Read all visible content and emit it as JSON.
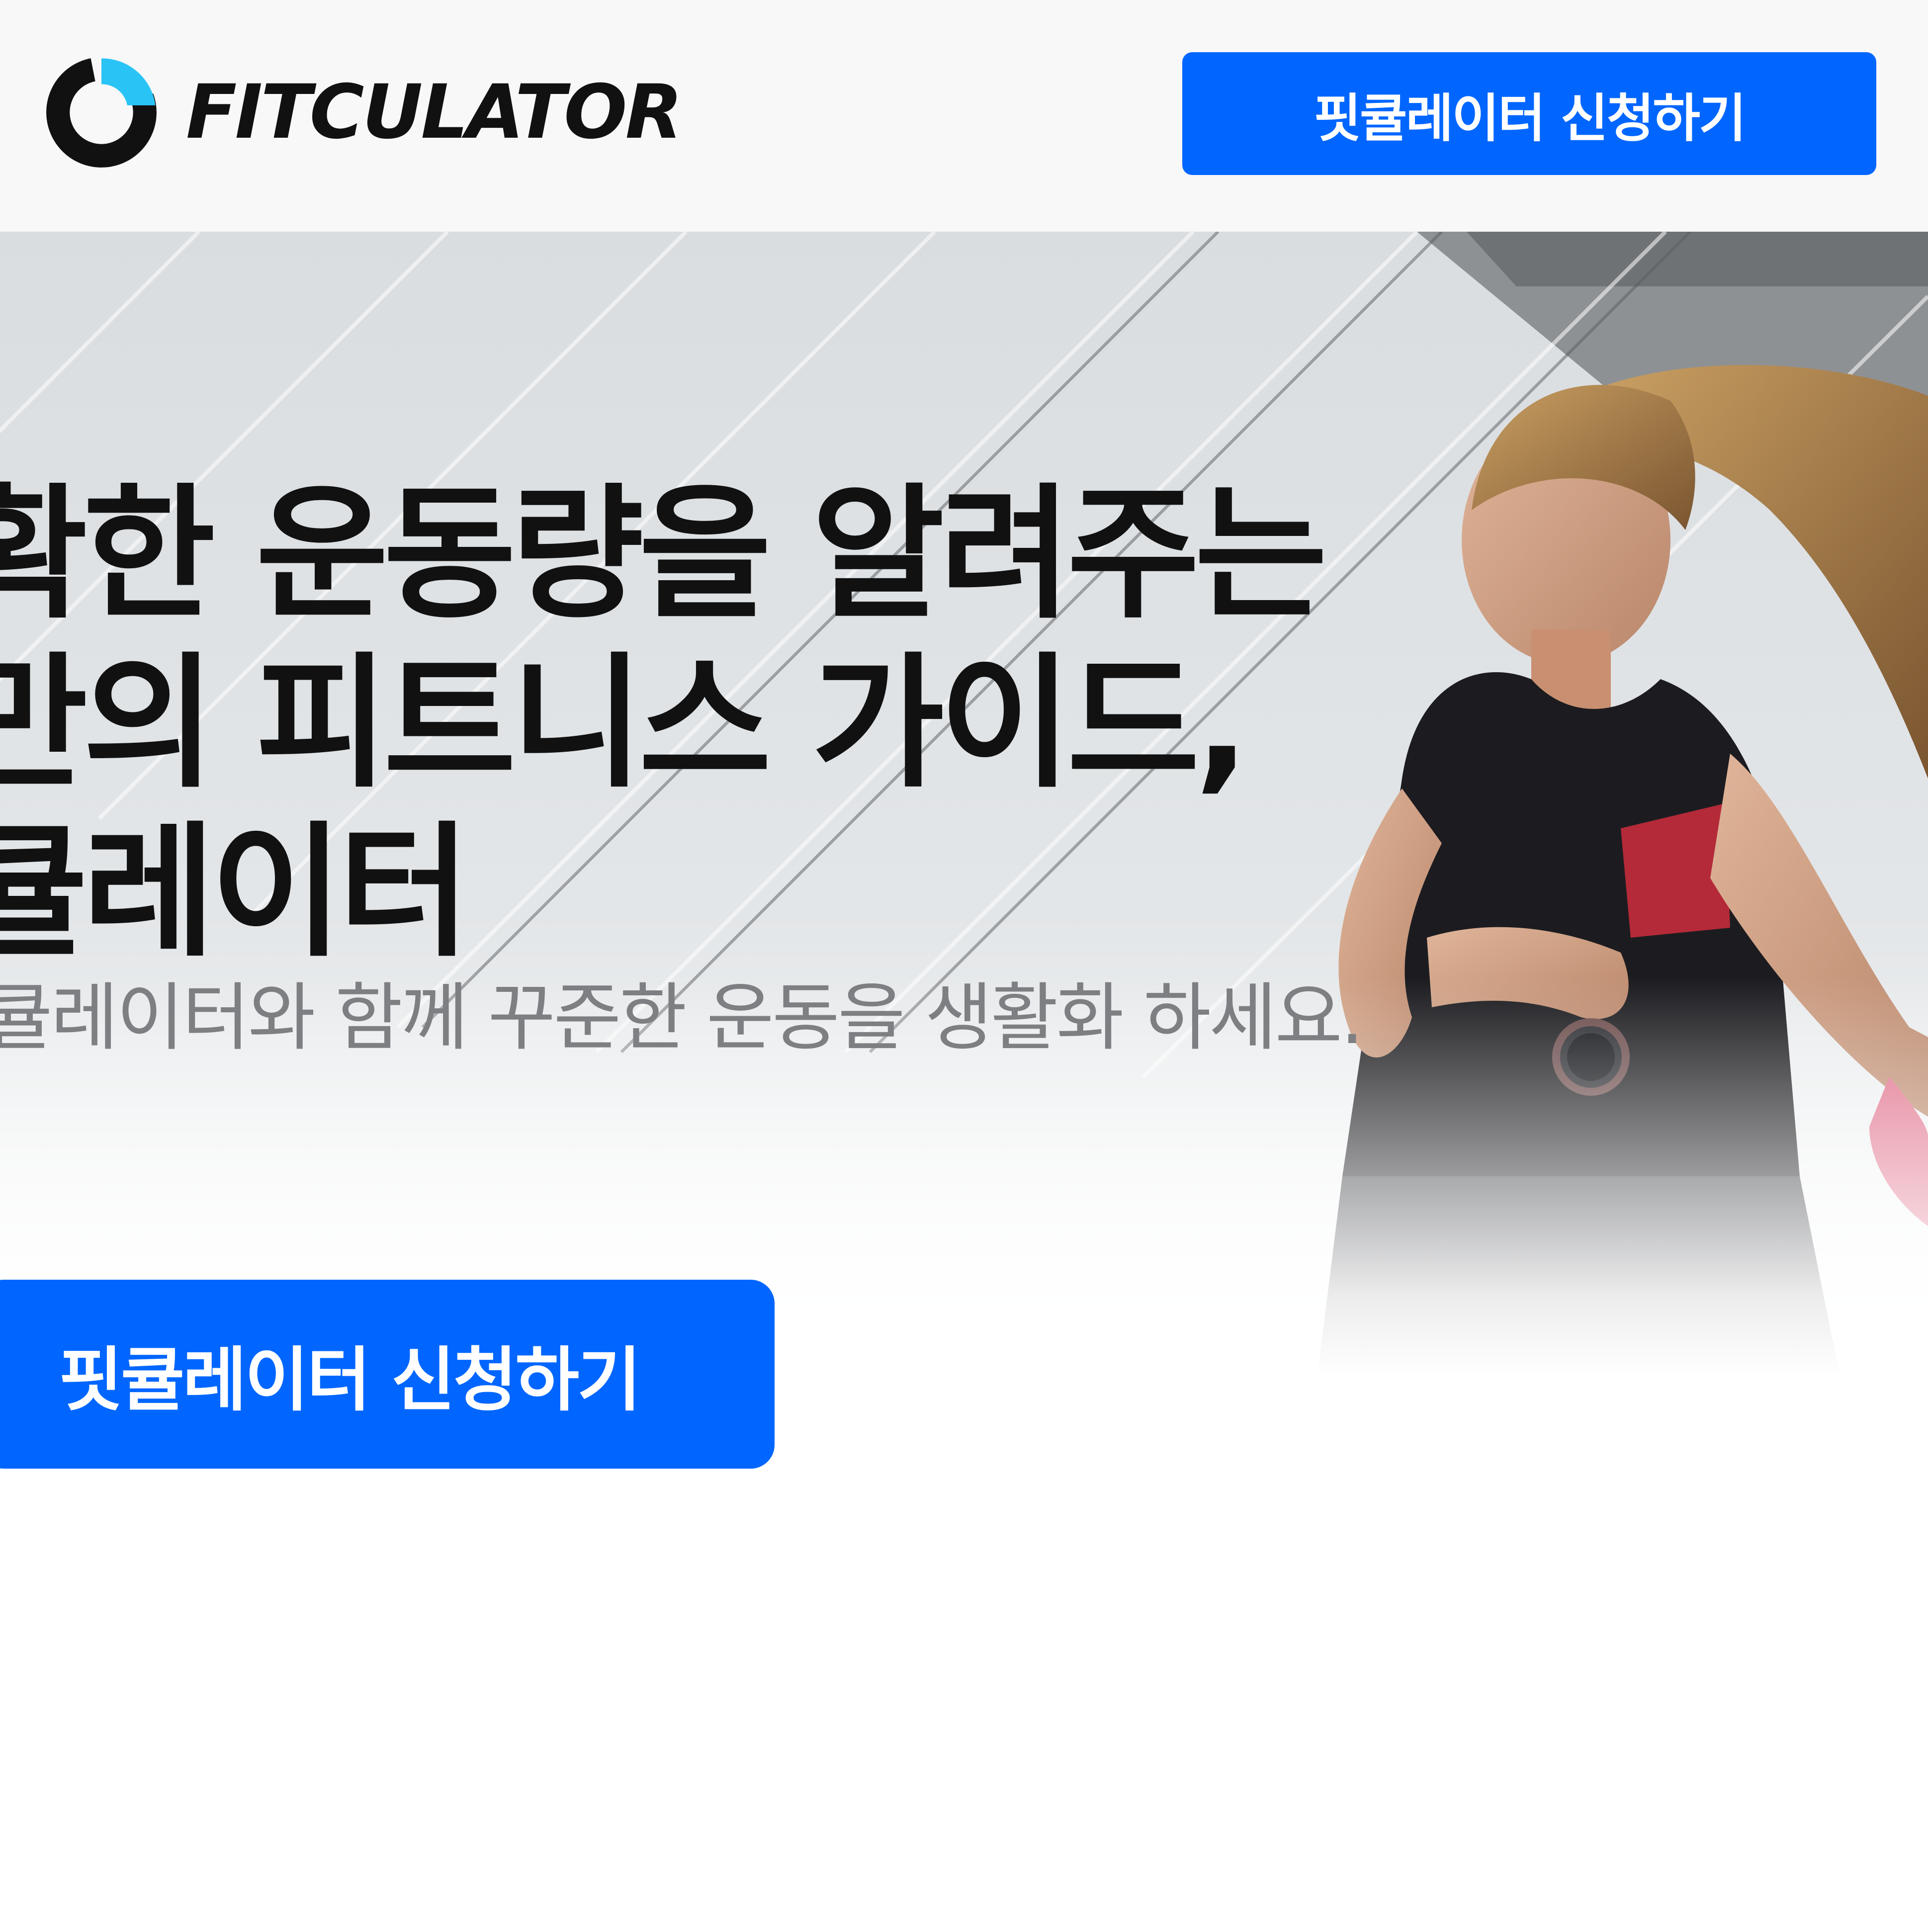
{
  "brand": {
    "logo_icon": "fitculator-ring-logo",
    "name": "FITCULATOR",
    "accent_color": "#29c4f5",
    "mark_color": "#111111"
  },
  "header": {
    "cta_label": "핏큘레이터 신청하기"
  },
  "hero": {
    "headline_lines": [
      "확한 운동량을 알려주는",
      "만의 피트니스 가이드,",
      "큘레이터"
    ],
    "subtext": "큘레이터와 함께 꾸준한 운동을 생활화 하세요.",
    "image": "woman-running-photo",
    "cta_label": "핏큘레이터 신청하기"
  },
  "colors": {
    "primary_button": "#0066ff",
    "button_text": "#ffffff",
    "headline_text": "#111111",
    "subtext": "#7d7f82",
    "header_bg": "#f8f8f8"
  }
}
